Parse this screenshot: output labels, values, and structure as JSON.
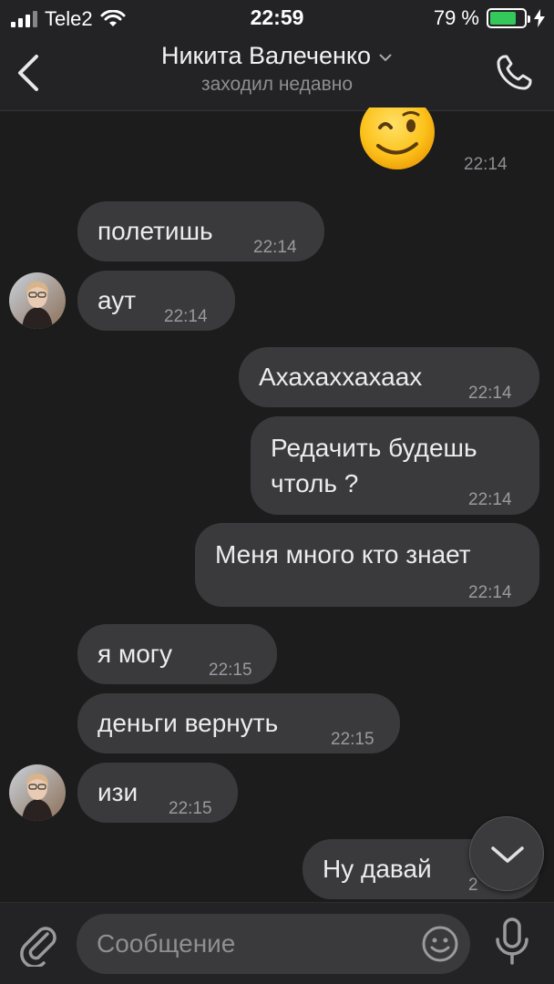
{
  "status_bar": {
    "carrier": "Tele2",
    "time": "22:59",
    "battery_percent": "79 %",
    "battery_level": 0.79,
    "colors": {
      "battery": "#34c759"
    }
  },
  "header": {
    "contact_name": "Никита Валеченко",
    "status": "заходил недавно",
    "icons": [
      "back-icon",
      "chevron-down-icon",
      "phone-icon"
    ]
  },
  "messages": [
    {
      "type": "emoji",
      "direction": "out",
      "text": "😉",
      "time": "22:14"
    },
    {
      "type": "text",
      "direction": "in",
      "text": "полетишь",
      "time": "22:14"
    },
    {
      "type": "text",
      "direction": "in",
      "text": "аут",
      "time": "22:14"
    },
    {
      "type": "text",
      "direction": "out",
      "text": "Ахахаххахаах",
      "time": "22:14"
    },
    {
      "type": "text",
      "direction": "out",
      "text_lines": [
        "Редачить будешь",
        "чтоль ?"
      ],
      "time": "22:14"
    },
    {
      "type": "text",
      "direction": "out",
      "text": "Меня много кто знает",
      "time": "22:14"
    },
    {
      "type": "text",
      "direction": "in",
      "text": "я могу",
      "time": "22:15"
    },
    {
      "type": "text",
      "direction": "in",
      "text": "деньги вернуть",
      "time": "22:15"
    },
    {
      "type": "text",
      "direction": "in",
      "text": "изи",
      "time": "22:15"
    },
    {
      "type": "text",
      "direction": "out",
      "text": "Ну давай",
      "time_partial": "2"
    }
  ],
  "input_bar": {
    "placeholder": "Сообщение",
    "icons": [
      "paperclip-icon",
      "smile-icon",
      "microphone-icon"
    ]
  },
  "scroll_button": {
    "icon": "chevron-down-icon"
  },
  "theme": {
    "background": "#1c1c1d",
    "bubble": "#3a3a3c",
    "bar": "#232325",
    "secondary_text": "#8e8e93"
  }
}
